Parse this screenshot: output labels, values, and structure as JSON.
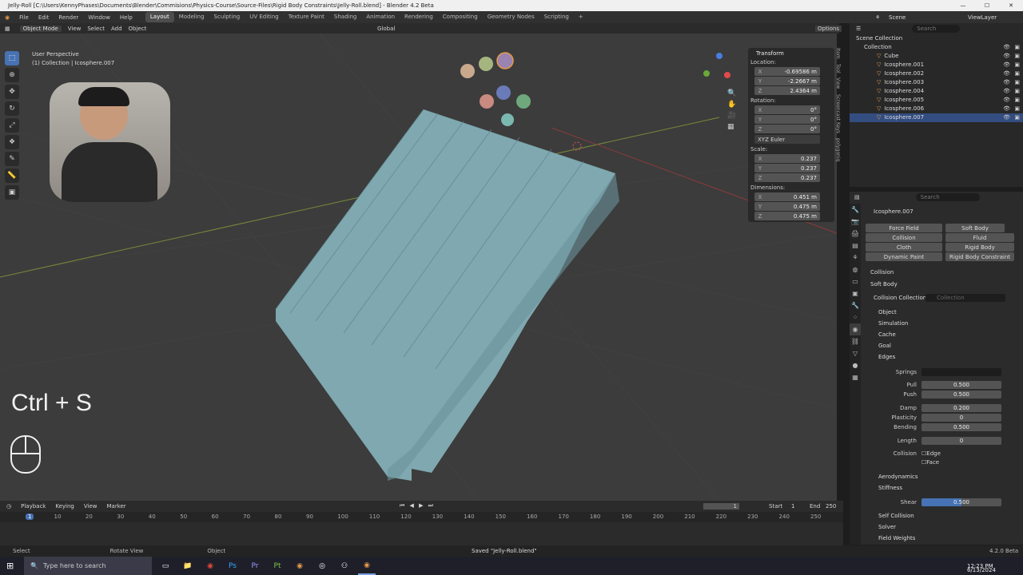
{
  "window": {
    "title": "Jelly-Roll [C:\\Users\\KennyPhases\\Documents\\Blender\\Commisions\\Physics-Course\\Source-Files\\Rigid Body Constraints\\Jelly-Roll.blend] - Blender 4.2 Beta"
  },
  "menu": [
    "File",
    "Edit",
    "Render",
    "Window",
    "Help"
  ],
  "workspaces": [
    "Layout",
    "Modeling",
    "Sculpting",
    "UV Editing",
    "Texture Paint",
    "Shading",
    "Animation",
    "Rendering",
    "Compositing",
    "Geometry Nodes",
    "Scripting"
  ],
  "active_workspace": "Layout",
  "scene": {
    "label": "Scene",
    "view_layer": "ViewLayer"
  },
  "header3d": {
    "mode": "Object Mode",
    "items": [
      "View",
      "Select",
      "Add",
      "Object"
    ],
    "transform": "Global",
    "options": "Options"
  },
  "viewport": {
    "perspective": "User Perspective",
    "collection_info": "(1) Collection | Icosphere.007",
    "shortcut": "Ctrl + S"
  },
  "npanel": {
    "title": "Transform",
    "location_label": "Location:",
    "location": [
      {
        "ax": "X",
        "v": "-0.69586 m"
      },
      {
        "ax": "Y",
        "v": "-2.2667 m"
      },
      {
        "ax": "Z",
        "v": "2.4364 m"
      }
    ],
    "rotation_label": "Rotation:",
    "rotation": [
      {
        "ax": "X",
        "v": "0°"
      },
      {
        "ax": "Y",
        "v": "0°"
      },
      {
        "ax": "Z",
        "v": "0°"
      }
    ],
    "rotation_mode": "XYZ Euler",
    "scale_label": "Scale:",
    "scale": [
      {
        "ax": "X",
        "v": "0.237"
      },
      {
        "ax": "Y",
        "v": "0.237"
      },
      {
        "ax": "Z",
        "v": "0.237"
      }
    ],
    "dimensions_label": "Dimensions:",
    "dimensions": [
      {
        "ax": "X",
        "v": "0.451 m"
      },
      {
        "ax": "Y",
        "v": "0.475 m"
      },
      {
        "ax": "Z",
        "v": "0.475 m"
      }
    ],
    "tabs": [
      "Item",
      "Tool",
      "View",
      "Screencast Keys",
      "polygoniq"
    ]
  },
  "outliner": {
    "search_placeholder": "Search",
    "scene_collection": "Scene Collection",
    "collection": "Collection",
    "items": [
      "Cube",
      "Icosphere.001",
      "Icosphere.002",
      "Icosphere.003",
      "Icosphere.004",
      "Icosphere.005",
      "Icosphere.006",
      "Icosphere.007"
    ],
    "selected": "Icosphere.007"
  },
  "properties": {
    "search_placeholder": "Search",
    "object": "Icosphere.007",
    "physics_buttons": [
      "Force Field",
      "Soft Body",
      "Collision",
      "Fluid",
      "Cloth",
      "Rigid Body",
      "Dynamic Paint",
      "Rigid Body Constraint"
    ],
    "sections": {
      "collision": "Collision",
      "soft_body": "Soft Body",
      "collision_collection": "Collision Collection",
      "collection_placeholder": "Collection",
      "object": "Object",
      "simulation": "Simulation",
      "cache": "Cache",
      "goal": "Goal",
      "edges": "Edges",
      "aerodynamics": "Aerodynamics",
      "stiffness": "Stiffness",
      "self_collision": "Self Collision",
      "solver": "Solver",
      "field_weights": "Field Weights"
    },
    "edges": {
      "springs_label": "Springs",
      "pull_label": "Pull",
      "pull": "0.500",
      "push_label": "Push",
      "push": "0.500",
      "damp_label": "Damp",
      "damp": "0.200",
      "plasticity_label": "Plasticity",
      "plasticity": "0",
      "bending_label": "Bending",
      "bending": "0.500",
      "length_label": "Length",
      "length": "0",
      "collision_label": "Collision",
      "edge": "Edge",
      "face": "Face"
    },
    "shear_label": "Shear",
    "shear": "0.500",
    "shear_fill": 0.5
  },
  "timeline": {
    "items": [
      "Playback",
      "Keying",
      "View",
      "Marker"
    ],
    "current_frame": "1",
    "start_label": "Start",
    "start": "1",
    "end_label": "End",
    "end": "250",
    "ticks": [
      "1",
      "10",
      "20",
      "30",
      "40",
      "50",
      "60",
      "70",
      "80",
      "90",
      "100",
      "110",
      "120",
      "130",
      "140",
      "150",
      "160",
      "170",
      "180",
      "190",
      "200",
      "210",
      "220",
      "230",
      "240",
      "250"
    ]
  },
  "status": {
    "select": "Select",
    "rotate": "Rotate View",
    "object": "Object",
    "saved": "Saved \"Jelly-Roll.blend\"",
    "version": "4.2.0 Beta"
  },
  "taskbar": {
    "search_placeholder": "Type here to search",
    "time": "12:23 PM",
    "date": "6/13/2024"
  },
  "colors": {
    "accent": "#4772b3",
    "selection": "#334d80",
    "stairs": "#7fa8b0",
    "orange": "#e39a4a"
  }
}
